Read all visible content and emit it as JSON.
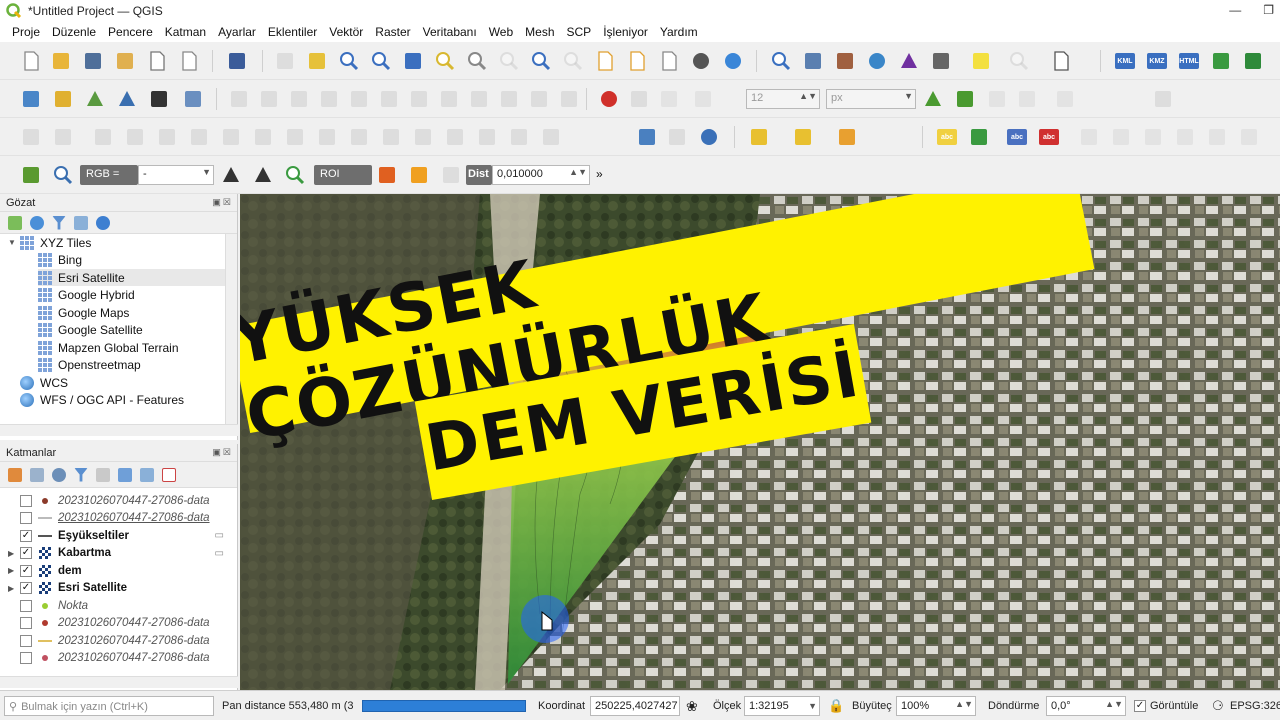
{
  "window": {
    "title": "*Untitled Project — QGIS"
  },
  "menu": [
    "Proje",
    "Düzenle",
    "Pencere",
    "Katman",
    "Ayarlar",
    "Eklentiler",
    "Vektör",
    "Raster",
    "Veritabanı",
    "Web",
    "Mesh",
    "SCP",
    "İşleniyor",
    "Yardım"
  ],
  "toolbar": {
    "font_size": "12",
    "font_unit": "px",
    "scp_rgb_label": "RGB =",
    "scp_rgb_value": "-",
    "scp_roi_label": "ROI",
    "scp_dist_label": "Dist",
    "scp_dist_value": "0,010000",
    "kml_label": "KML",
    "kmz_label": "KMZ",
    "html_label": "HTML",
    "abc_label": "abc",
    "more": "»"
  },
  "browser": {
    "title": "Gözat",
    "items": [
      {
        "label": "XYZ Tiles",
        "level": 0,
        "icon": "grid-icon",
        "expanded": true
      },
      {
        "label": "Bing",
        "level": 1,
        "icon": "grid-icon"
      },
      {
        "label": "Esri Satellite",
        "level": 1,
        "icon": "grid-icon",
        "selected": true
      },
      {
        "label": "Google Hybrid",
        "level": 1,
        "icon": "grid-icon"
      },
      {
        "label": "Google Maps",
        "level": 1,
        "icon": "grid-icon"
      },
      {
        "label": "Google Satellite",
        "level": 1,
        "icon": "grid-icon"
      },
      {
        "label": "Mapzen Global Terrain",
        "level": 1,
        "icon": "grid-icon"
      },
      {
        "label": "Openstreetmap",
        "level": 1,
        "icon": "grid-icon"
      },
      {
        "label": "WCS",
        "level": 0,
        "icon": "globe-icon"
      },
      {
        "label": "WFS / OGC API - Features",
        "level": 0,
        "icon": "globe-icon"
      }
    ]
  },
  "layers": {
    "title": "Katmanlar",
    "items": [
      {
        "label": "20231026070447-27086-data",
        "checked": false,
        "style": "italic",
        "symbol": "dot",
        "color": "#8b3a2a"
      },
      {
        "label": "20231026070447-27086-data",
        "checked": false,
        "style": "italic-underline",
        "symbol": "line",
        "color": "#bbbbbb"
      },
      {
        "label": "Eşyükseltiler",
        "checked": true,
        "style": "bold",
        "symbol": "line",
        "color": "#555555"
      },
      {
        "label": "Kabartma",
        "checked": true,
        "style": "bold",
        "symbol": "raster",
        "color": "#333333"
      },
      {
        "label": "dem",
        "checked": true,
        "style": "bold",
        "symbol": "raster",
        "color": "#333333"
      },
      {
        "label": "Esri Satellite",
        "checked": true,
        "style": "bold",
        "symbol": "raster",
        "color": "#333333"
      },
      {
        "label": "Nokta",
        "checked": false,
        "style": "italic",
        "symbol": "dot",
        "color": "#9acd32"
      },
      {
        "label": "20231026070447-27086-data",
        "checked": false,
        "style": "italic",
        "symbol": "dot",
        "color": "#b03a2e"
      },
      {
        "label": "20231026070447-27086-data",
        "checked": false,
        "style": "italic",
        "symbol": "line",
        "color": "#e0c060"
      },
      {
        "label": "20231026070447-27086-data",
        "checked": false,
        "style": "italic",
        "symbol": "dot",
        "color": "#c05060"
      }
    ]
  },
  "overlay": {
    "line1": "YÜKSEK ÇÖZÜNÜRLÜK",
    "line2": "DEM VERİSİ",
    "color": "#fff200"
  },
  "status": {
    "search_placeholder": "Bulmak için yazın (Ctrl+K)",
    "message": "Pan distance 553,480 m (3:",
    "coord_label": "Koordinat",
    "coord_value": "250225,4027427",
    "scale_label": "Ölçek",
    "scale_value": "1:32195",
    "zoom_label": "Büyüteç",
    "zoom_value": "100%",
    "rotation_label": "Döndürme",
    "rotation_value": "0,0°",
    "render_label": "Görüntüle",
    "crs_label": "EPSG:326"
  }
}
